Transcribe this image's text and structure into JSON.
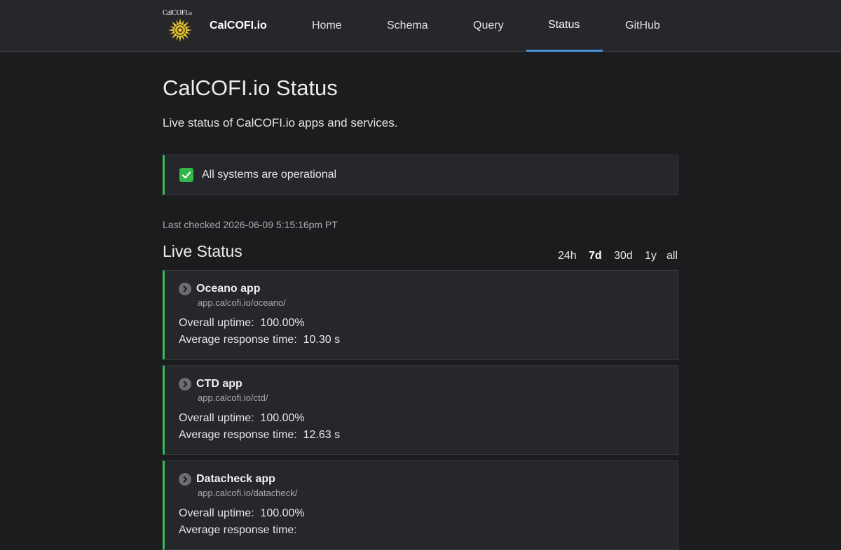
{
  "header": {
    "logo_text": "CalCOFI",
    "logo_suffix": ".io",
    "brand": "CalCOFI.io",
    "nav": [
      {
        "label": "Home"
      },
      {
        "label": "Schema"
      },
      {
        "label": "Query"
      },
      {
        "label": "Status",
        "active": true
      },
      {
        "label": "GitHub"
      }
    ],
    "accent_color": "#4a90d9"
  },
  "page": {
    "title": "CalCOFI.io Status",
    "subtitle": "Live status of CalCOFI.io apps and services."
  },
  "banner": {
    "icon": "check-icon",
    "text": "All systems are operational",
    "status_color": "#2fbf5c"
  },
  "last_checked": "Last checked 2026-06-09 5:15:16pm PT",
  "live_status": {
    "title": "Live Status",
    "ranges": [
      "24h",
      "7d",
      "30d",
      "1y",
      "all"
    ],
    "selected_range": "7d"
  },
  "services": [
    {
      "name": "Oceano app",
      "url": "app.calcofi.io/oceano/",
      "uptime_label": "Overall uptime:",
      "uptime": "100.00%",
      "response_label": "Average response time:",
      "response": "10.30 s"
    },
    {
      "name": "CTD app",
      "url": "app.calcofi.io/ctd/",
      "uptime_label": "Overall uptime:",
      "uptime": "100.00%",
      "response_label": "Average response time:",
      "response": "12.63 s"
    },
    {
      "name": "Datacheck app",
      "url": "app.calcofi.io/datacheck/",
      "uptime_label": "Overall uptime:",
      "uptime": "100.00%",
      "response_label": "Average response time:",
      "response": ""
    }
  ]
}
